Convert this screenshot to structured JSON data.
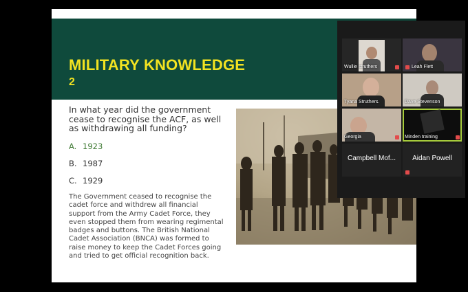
{
  "slide": {
    "title": "MILITARY KNOWLEDGE",
    "number": "2",
    "question": "In what year did the government cease to recognise the ACF, as well as withdrawing all funding?",
    "options": [
      {
        "letter": "A.",
        "text": "1923",
        "correct": true
      },
      {
        "letter": "B.",
        "text": "1987",
        "correct": false
      },
      {
        "letter": "C.",
        "text": "1929",
        "correct": false
      }
    ],
    "explanation": "The Government ceased to recognise the cadet force and withdrew all financial support from the Army Cadet Force, they even stopped them from wearing regimental badges and buttons. The British National Cadet Association (BNCA) was formed to raise money to keep the Cadet Forces going and tried to get official recognition back.",
    "photo_caption": "",
    "colors": {
      "header_bg": "#0f4a3c",
      "title": "#f2e321",
      "correct": "#3f7a34"
    }
  },
  "participants": [
    {
      "name": "Wullie struthers",
      "muted": true,
      "video": true
    },
    {
      "name": "Leah Flett",
      "muted": true,
      "video": true
    },
    {
      "name": "Tyana Struthers.",
      "muted": false,
      "video": true
    },
    {
      "name": "Dave Stevenson",
      "muted": false,
      "video": true
    },
    {
      "name": "Georgia",
      "muted": true,
      "video": true
    },
    {
      "name": "Minden training",
      "muted": true,
      "video": true,
      "active": true
    },
    {
      "name": "Campbell Mof...",
      "muted": false,
      "video": false
    },
    {
      "name": "Aidan Powell",
      "muted": true,
      "video": false
    }
  ]
}
